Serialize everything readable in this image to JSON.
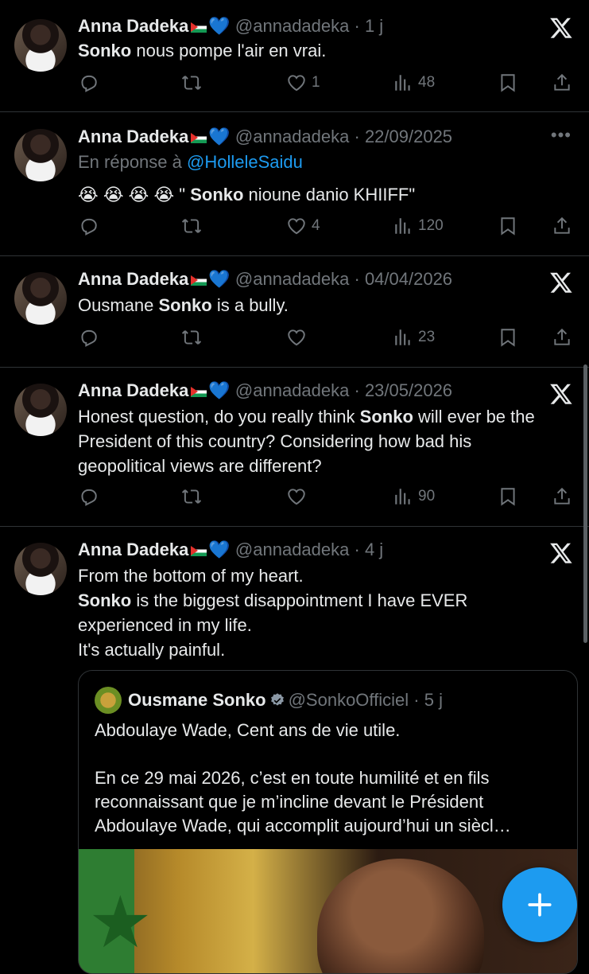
{
  "author": {
    "name": "Anna Dadeka",
    "handle": "@annadadeka",
    "heart_emoji": "💙"
  },
  "tweets": [
    {
      "time": "1 j",
      "text_parts": [
        {
          "b": "Sonko"
        },
        {
          "t": " nous pompe l'air en vrai."
        }
      ],
      "likes": "1",
      "views": "48",
      "corner": "x"
    },
    {
      "time": "22/09/2025",
      "reply_prefix": "En réponse à ",
      "reply_to": "@HolleleSaidu",
      "text_parts": [
        {
          "t": "😭 😭 😭 😭  \" "
        },
        {
          "b": "Sonko"
        },
        {
          "t": " nioune danio KHIIFF\""
        }
      ],
      "likes": "4",
      "views": "120",
      "corner": "more"
    },
    {
      "time": "04/04/2026",
      "text_parts": [
        {
          "t": "Ousmane "
        },
        {
          "b": "Sonko"
        },
        {
          "t": " is a bully."
        }
      ],
      "likes": "",
      "views": "23",
      "corner": "x"
    },
    {
      "time": "23/05/2026",
      "text_parts": [
        {
          "t": "Honest question, do you really think "
        },
        {
          "b": "Sonko"
        },
        {
          "t": " will ever be the President of this country? Considering how bad his geopolitical views are different?"
        }
      ],
      "likes": "",
      "views": "90",
      "corner": "x"
    },
    {
      "time": "4 j",
      "text_parts": [
        {
          "t": "From the bottom of my heart.\n"
        },
        {
          "b": "Sonko"
        },
        {
          "t": " is the biggest disappointment I have EVER experienced in my life.\nIt's actually painful."
        }
      ],
      "corner": "x"
    }
  ],
  "quote": {
    "name": "Ousmane Sonko",
    "handle": "@SonkoOfficiel",
    "time": "5 j",
    "line1": "Abdoulaye Wade, Cent ans de vie utile.",
    "line2": "En ce 29 mai 2026, c’est en toute humilité et en fils reconnaissant que je m’incline devant le Président Abdoulaye Wade, qui accomplit aujourd’hui un siècl…"
  },
  "colors": {
    "accent": "#1d9bf0",
    "muted": "#71767b",
    "text": "#e7e9ea",
    "border": "#2f3336"
  }
}
